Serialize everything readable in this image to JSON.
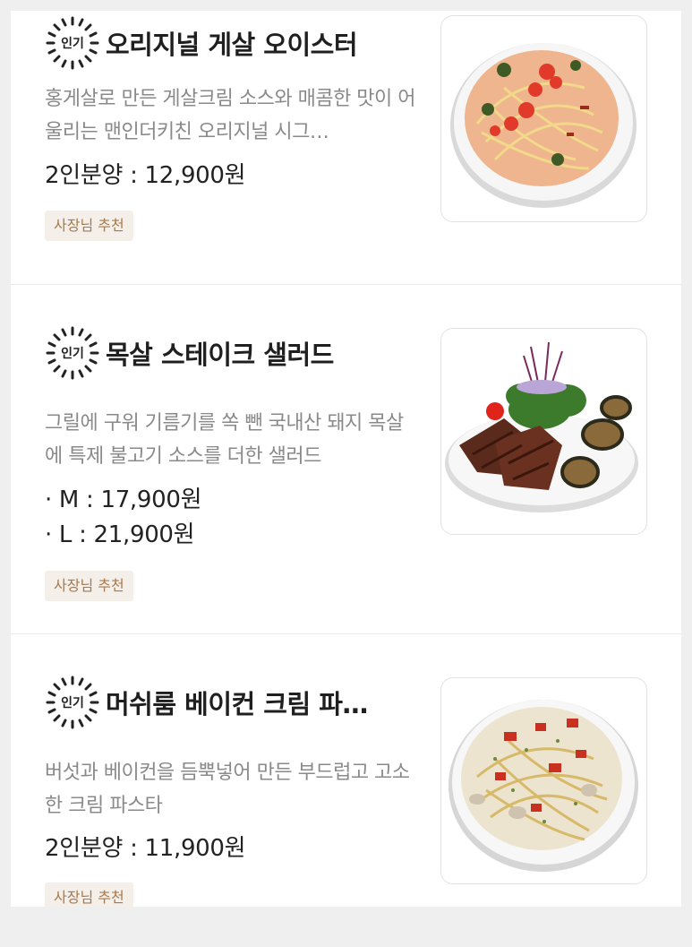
{
  "badge_label": "인기",
  "tag_label": "사장님 추천",
  "items": [
    {
      "title": "오리지널 게살 오이스터",
      "description": "홍게살로 만든 게살크림 소스와 매콤한 맛이 어울리는 맨인더키친 오리지널 시그…",
      "prices": [
        "2인분양 : 12,900원"
      ],
      "image_icon": "crab-cream-pasta-image"
    },
    {
      "title": "목살 스테이크 샐러드",
      "description": "그릴에 구워 기름기를 쏙 뺀 국내산 돼지 목살에 특제 불고기 소스를 더한 샐러드",
      "prices": [
        "· M : 17,900원",
        "· L : 21,900원"
      ],
      "image_icon": "pork-steak-salad-image"
    },
    {
      "title": "머쉬룸 베이컨 크림 파…",
      "description": "버섯과 베이컨을 듬뿍넣어 만든 부드럽고 고소한 크림 파스타",
      "prices": [
        "2인분양 : 11,900원"
      ],
      "image_icon": "mushroom-bacon-cream-pasta-image"
    }
  ]
}
